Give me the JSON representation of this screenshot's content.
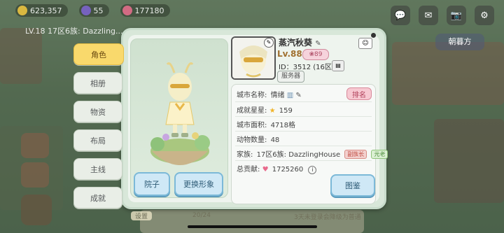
{
  "topbar": {
    "coins": "623,357",
    "gems": "55",
    "hearts": "177180",
    "level_line": "LV.18  17区6族: Dazzling..."
  },
  "right_buttons": {
    "guild_label": "朝暮方"
  },
  "tabs": [
    {
      "label": "角色",
      "active": true
    },
    {
      "label": "相册",
      "active": false
    },
    {
      "label": "物资",
      "active": false
    },
    {
      "label": "布局",
      "active": false
    },
    {
      "label": "主线",
      "active": false
    },
    {
      "label": "成就",
      "active": false
    }
  ],
  "character": {
    "yard_button": "院子",
    "change_look_button": "更换形象"
  },
  "profile": {
    "name": "蒸汽秋葵",
    "level": "Lv.88",
    "badge": "89",
    "id_line": "ID：3512 (16区)",
    "server_button": "服务器"
  },
  "stats": {
    "city_name_key": "城市名称:",
    "city_name_val": "情绪",
    "rank_button": "排名",
    "stars_key": "成就星星:",
    "stars_val": "159",
    "area_key": "城市面积:",
    "area_val": "4718格",
    "animals_key": "动物数量:",
    "animals_val": "48",
    "family_key": "家族:",
    "family_val": "17区6族: DazzlingHouse",
    "tag_vice": "副族长",
    "tag_elder": "元老",
    "contrib_key": "总贡献:",
    "contrib_val": "1725260"
  },
  "gallery_button": "图鉴",
  "bottom_strip": {
    "settings": "设置",
    "count": "20/24",
    "hint": "3天未登录会降级为普通"
  },
  "colors": {
    "active_tab": "#f9d96c",
    "blue_button": "#cfe8f6",
    "rank_pink": "#f7c9d2"
  }
}
